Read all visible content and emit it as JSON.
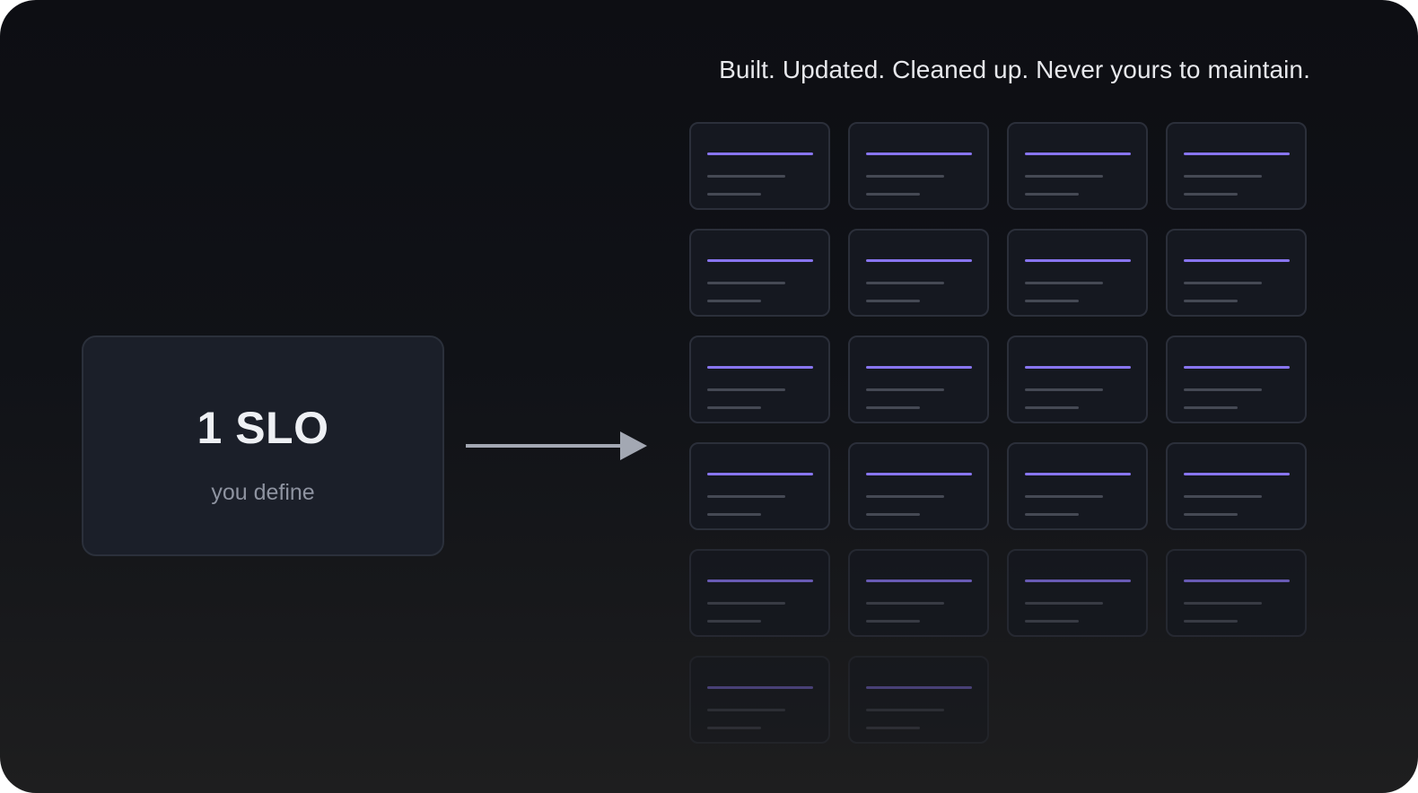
{
  "headline": "Built. Updated. Cleaned up. Never yours to maintain.",
  "slo_card": {
    "title": "1 SLO",
    "subtitle": "you define"
  },
  "generated_grid": {
    "tile_count": 22,
    "columns": 4
  },
  "colors": {
    "background": "#0d0e13",
    "card_fill": "#1b1f29",
    "tile_fill": "#151820",
    "accent_line": "#8875f0",
    "muted_line": "#454954",
    "arrow": "#a3a8b3"
  }
}
